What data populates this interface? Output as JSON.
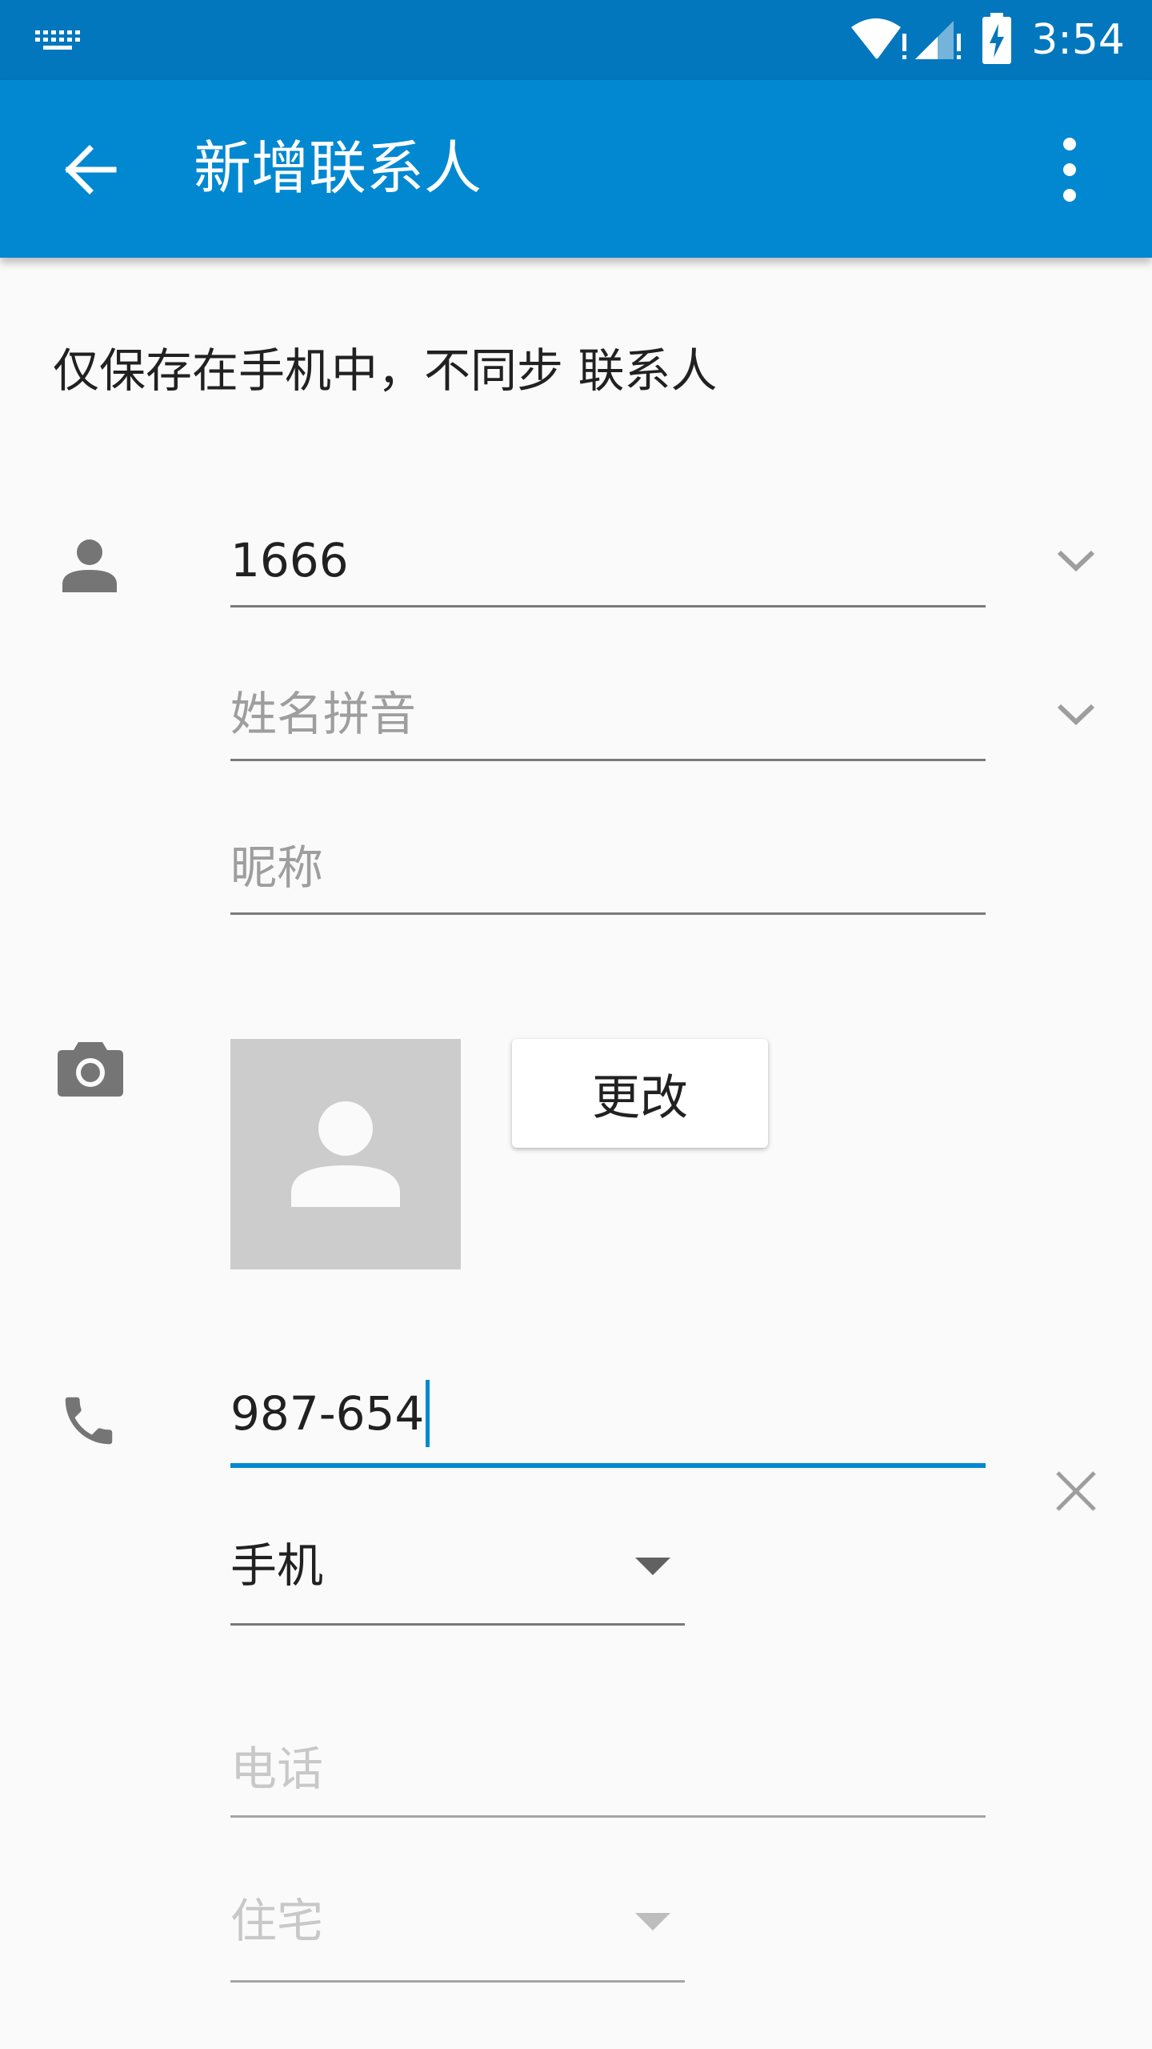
{
  "status_bar": {
    "time": "3:54"
  },
  "app_bar": {
    "title": "新增联系人"
  },
  "info_text": "仅保存在手机中，不同步 联系人",
  "name_section": {
    "name_value": "1666",
    "phonetic_placeholder": "姓名拼音",
    "nickname_placeholder": "昵称"
  },
  "photo_section": {
    "change_label": "更改"
  },
  "phone_section": {
    "phone_value": "987-654",
    "phone_type": "手机",
    "next_phone_placeholder": "电话",
    "next_phone_type": "住宅"
  },
  "colors": {
    "status_bar": "#0277bd",
    "app_bar": "#0288d1",
    "accent": "#0288d1"
  },
  "icons": [
    "keyboard-icon",
    "wifi-icon",
    "signal-icon",
    "battery-charging-icon",
    "back-arrow-icon",
    "more-vert-icon",
    "person-icon",
    "chevron-down-icon",
    "camera-icon",
    "avatar-placeholder-icon",
    "phone-icon",
    "close-icon",
    "dropdown-arrow-icon"
  ]
}
